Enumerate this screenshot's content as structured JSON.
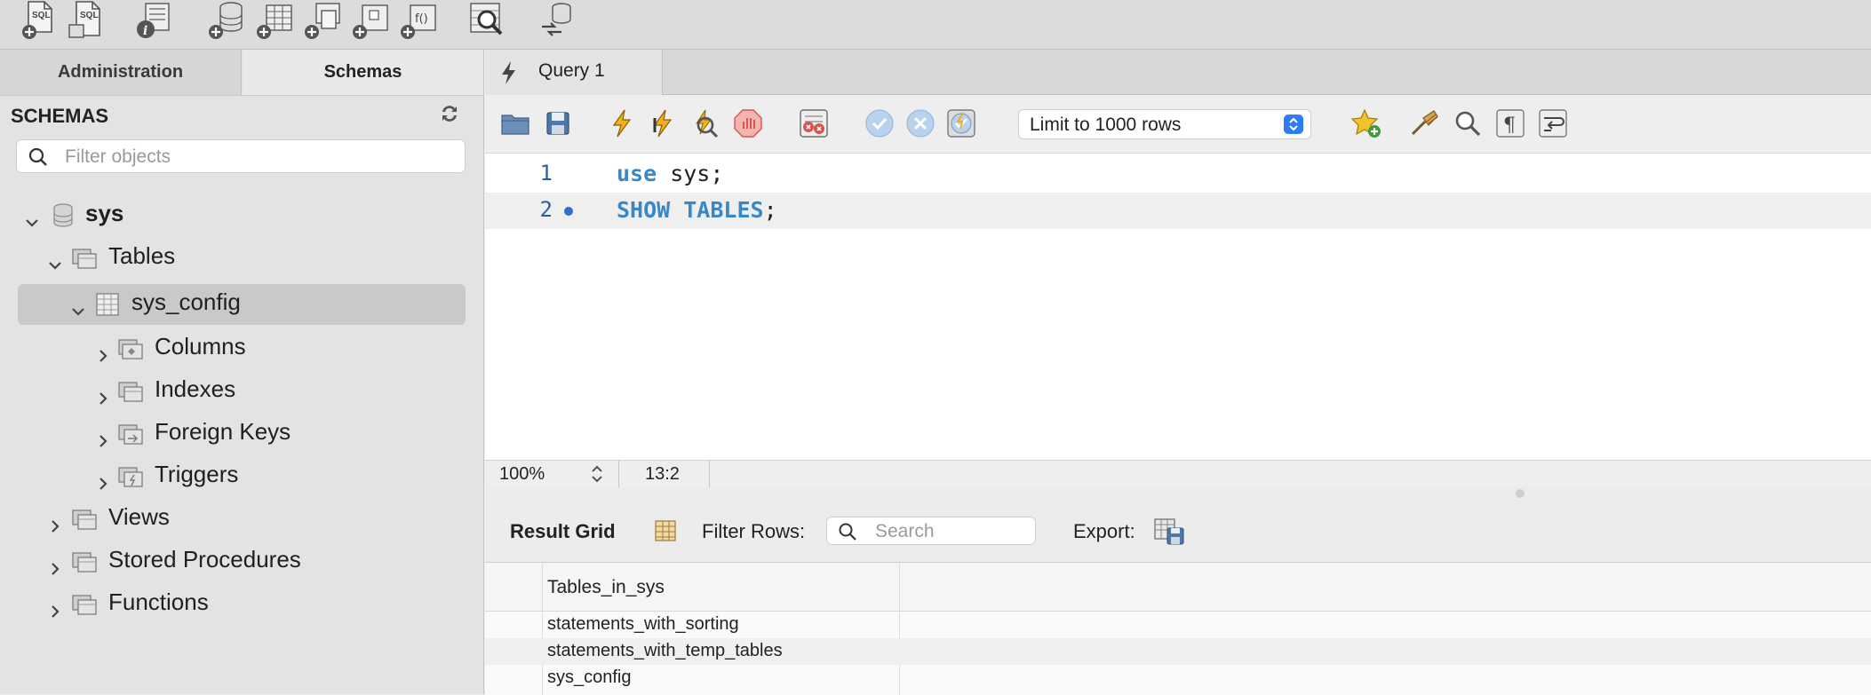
{
  "top_toolbar": {
    "icons": [
      "new-sql-tab-icon",
      "open-sql-script-icon",
      "inspector-icon",
      "create-schema-icon",
      "create-table-icon",
      "create-view-icon",
      "create-procedure-icon",
      "create-function-icon",
      "search-table-data-icon",
      "reconnect-icon"
    ]
  },
  "left_panel": {
    "tabs": [
      {
        "label": "Administration"
      },
      {
        "label": "Schemas"
      }
    ],
    "header": "SCHEMAS",
    "filter_placeholder": "Filter objects",
    "tree": {
      "schema": "sys",
      "tables_label": "Tables",
      "table": "sys_config",
      "table_children": [
        "Columns",
        "Indexes",
        "Foreign Keys",
        "Triggers"
      ],
      "schema_children": [
        "Views",
        "Stored Procedures",
        "Functions"
      ]
    }
  },
  "query_tab": {
    "label": "Query 1"
  },
  "editor_toolbar": {
    "limit_value": "Limit to 1000 rows"
  },
  "editor": {
    "lines": [
      {
        "number": "1",
        "keyword": "use",
        "rest": " sys;"
      },
      {
        "number": "2",
        "keyword": "SHOW TABLES",
        "rest": ";"
      }
    ]
  },
  "status": {
    "zoom": "100%",
    "cursor": "13:2"
  },
  "results": {
    "grid_label": "Result Grid",
    "filter_label": "Filter Rows:",
    "search_placeholder": "Search",
    "export_label": "Export:",
    "column": "Tables_in_sys",
    "rows": [
      "statements_with_sorting",
      "statements_with_temp_tables",
      "sys_config"
    ]
  }
}
